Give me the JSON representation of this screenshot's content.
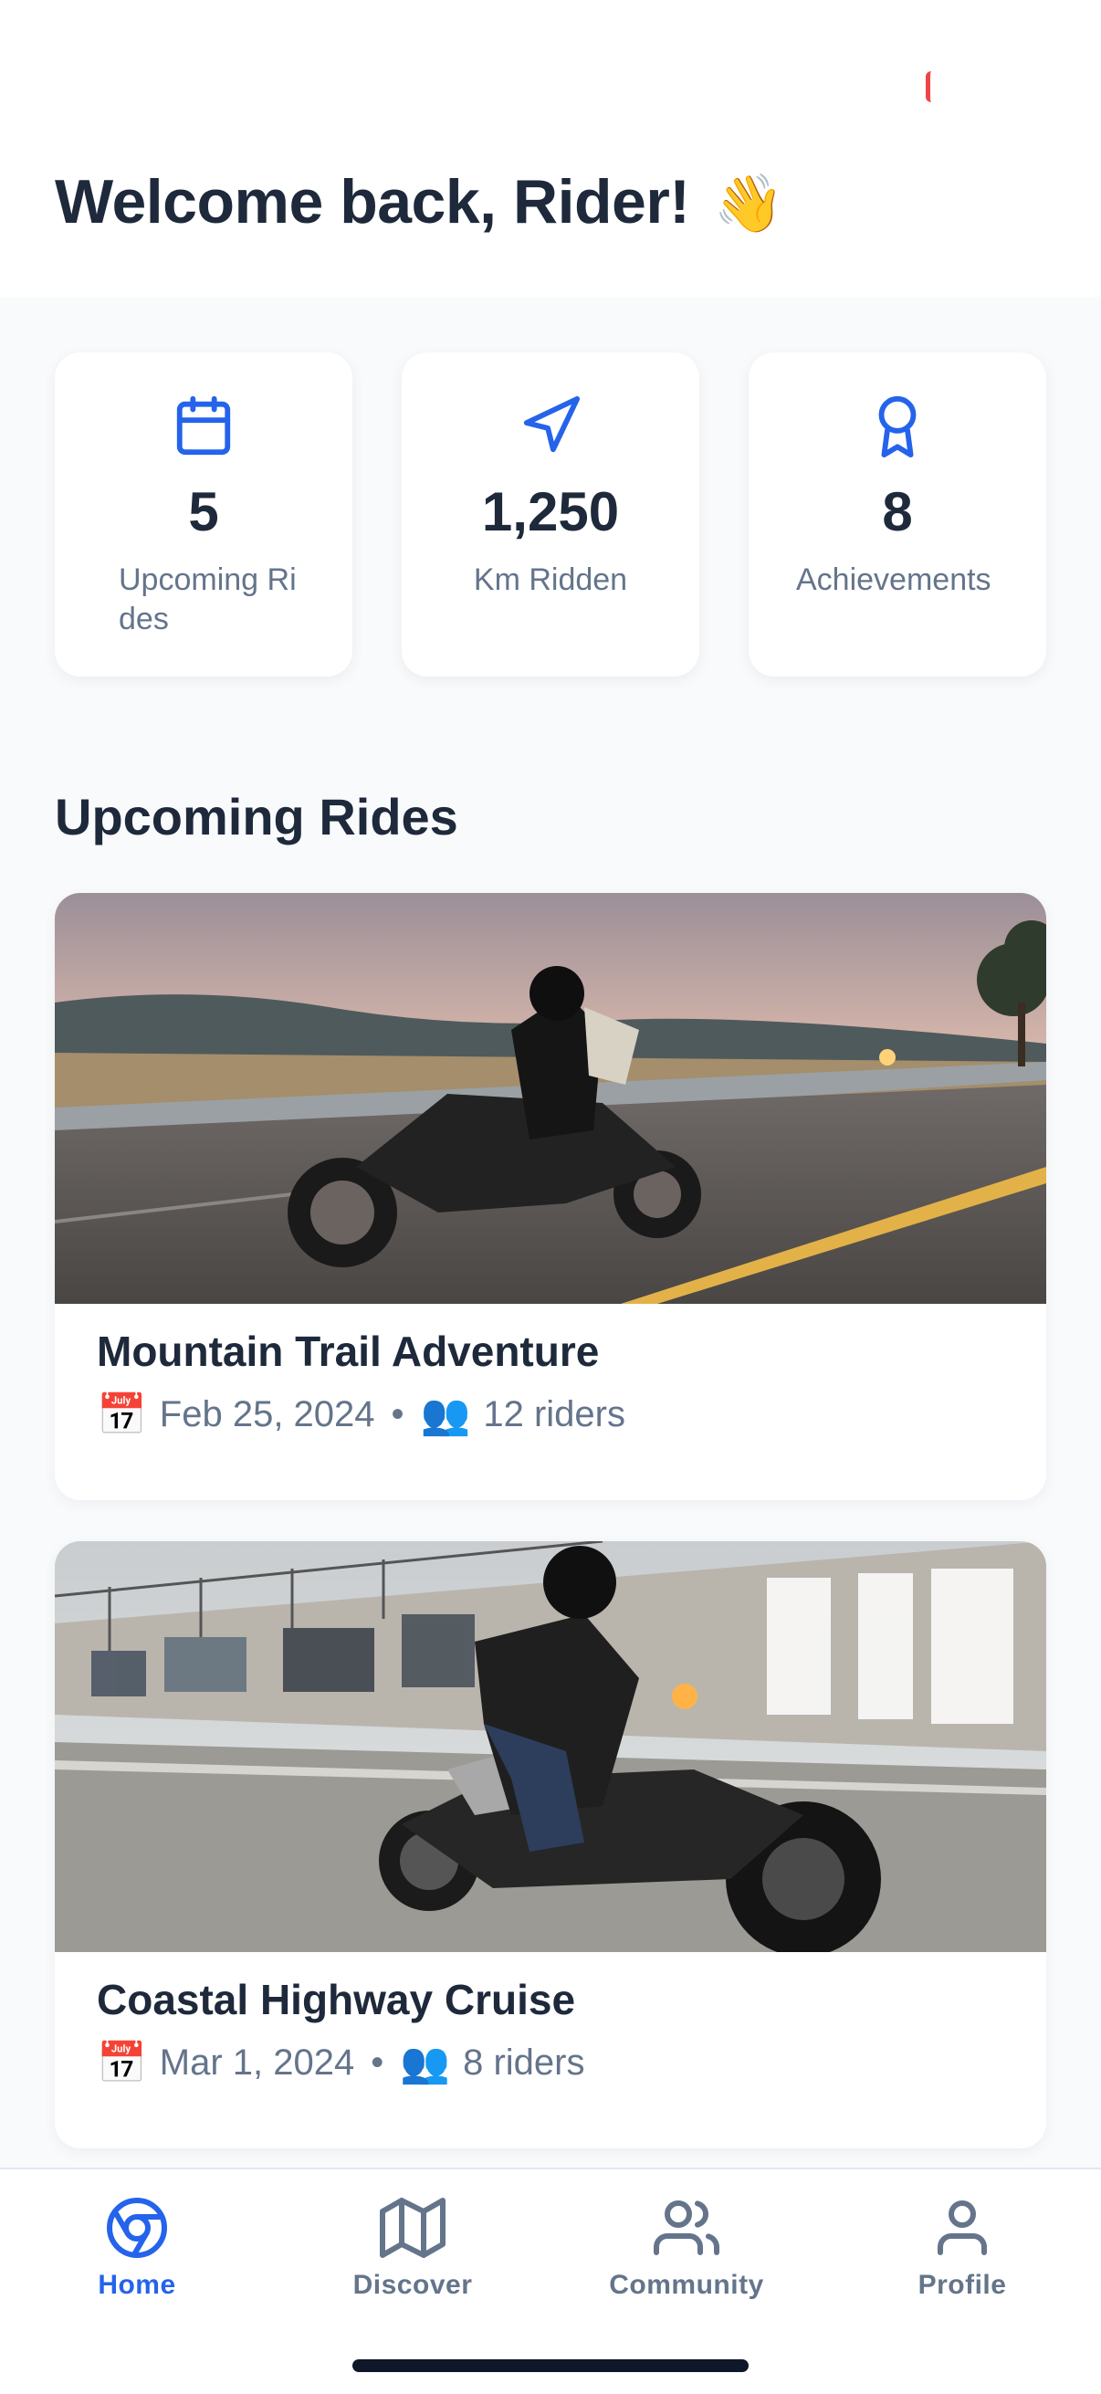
{
  "header": {
    "welcome_text": "Welcome back, Rider!",
    "wave_emoji": "👋"
  },
  "stats": [
    {
      "icon": "calendar-icon",
      "value": "5",
      "label": "Upcoming Rides"
    },
    {
      "icon": "navigation-icon",
      "value": "1,250",
      "label": "Km Ridden"
    },
    {
      "icon": "award-icon",
      "value": "8",
      "label": "Achievements"
    }
  ],
  "section": {
    "title": "Upcoming Rides"
  },
  "rides": [
    {
      "title": "Mountain Trail Adventure",
      "date_emoji": "📅",
      "date": "Feb 25, 2024",
      "separator": "•",
      "riders_emoji": "👥",
      "riders": "12 riders"
    },
    {
      "title": "Coastal Highway Cruise",
      "date_emoji": "📅",
      "date": "Mar 1, 2024",
      "separator": "•",
      "riders_emoji": "👥",
      "riders": "8 riders"
    }
  ],
  "nav": {
    "items": [
      {
        "label": "Home",
        "icon": "home-icon",
        "active": true
      },
      {
        "label": "Discover",
        "icon": "map-icon",
        "active": false
      },
      {
        "label": "Community",
        "icon": "users-icon",
        "active": false
      },
      {
        "label": "Profile",
        "icon": "user-icon",
        "active": false
      }
    ]
  },
  "colors": {
    "accent": "#2563eb",
    "text": "#1e293b",
    "muted": "#64748b",
    "background": "#f8fafc"
  }
}
